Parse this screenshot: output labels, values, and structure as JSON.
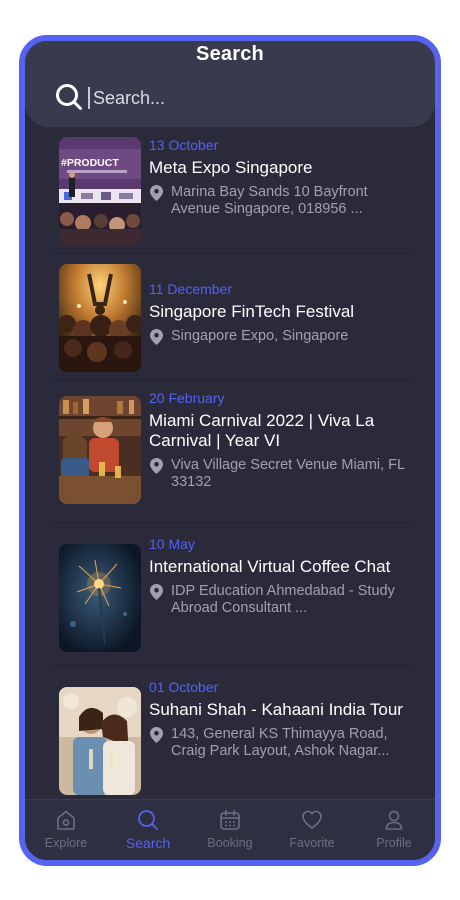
{
  "header": {
    "title": "Search"
  },
  "search": {
    "placeholder": "Search..."
  },
  "events": [
    {
      "date": "13 October",
      "name": "Meta Expo Singapore",
      "location": "Marina Bay Sands 10 Bayfront Avenue Singapore, 018956 ...",
      "thumb_text": "#PRODUCT"
    },
    {
      "date": "11 December",
      "name": "Singapore FinTech Festival",
      "location": "Singapore Expo, Singapore"
    },
    {
      "date": "20 February",
      "name": "Miami Carnival 2022 | Viva La Carnival | Year VI",
      "location": "Viva Village Secret Venue Miami, FL 33132"
    },
    {
      "date": "10 May",
      "name": "International Virtual Coffee Chat",
      "location": "IDP Education Ahmedabad - Study Abroad Consultant ..."
    },
    {
      "date": "01 October",
      "name": "Suhani Shah - Kahaani India Tour",
      "location": "143, General KS Thimayya Road, Craig Park Layout, Ashok Nagar..."
    }
  ],
  "nav": {
    "active": "Search",
    "items": [
      {
        "label": "Explore",
        "icon": "home-icon"
      },
      {
        "label": "Search",
        "icon": "search-icon"
      },
      {
        "label": "Booking",
        "icon": "calendar-icon"
      },
      {
        "label": "Favorite",
        "icon": "heart-icon"
      },
      {
        "label": "Profile",
        "icon": "user-icon"
      }
    ]
  },
  "colors": {
    "accent": "#5662f0",
    "background": "#2a2a3b",
    "header": "#383a4e",
    "muted": "#a0a1b0"
  }
}
